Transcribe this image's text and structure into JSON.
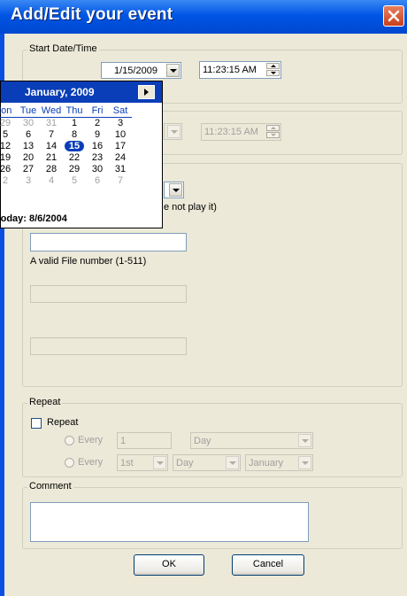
{
  "window": {
    "title": "Add/Edit your event"
  },
  "start": {
    "legend": "Start Date/Time",
    "date": "1/15/2009",
    "time": "11:23:15 AM"
  },
  "end": {
    "time": "11:23:15 AM"
  },
  "calendar": {
    "month": "January, 2009",
    "weekdays": [
      "lon",
      "Tue",
      "Wed",
      "Thu",
      "Fri",
      "Sat"
    ],
    "weeks": [
      [
        "29",
        "30",
        "31",
        "1",
        "2",
        "3"
      ],
      [
        "5",
        "6",
        "7",
        "8",
        "9",
        "10"
      ],
      [
        "12",
        "13",
        "14",
        "15",
        "16",
        "17"
      ],
      [
        "19",
        "20",
        "21",
        "22",
        "23",
        "24"
      ],
      [
        "26",
        "27",
        "28",
        "29",
        "30",
        "31"
      ],
      [
        "2",
        "3",
        "4",
        "5",
        "6",
        "7"
      ]
    ],
    "selected": "15",
    "today": "'oday: 8/6/2004"
  },
  "action": {
    "note": "e not play it)",
    "file_hint": "A valid File number (1-511)"
  },
  "repeat": {
    "legend": "Repeat",
    "checkbox_label": "Repeat",
    "every_label": "Every",
    "every_value": "1",
    "every_unit": "Day",
    "every2_label": "Every",
    "ordinal": "1st",
    "day": "Day",
    "month": "January"
  },
  "comment": {
    "legend": "Comment",
    "value": ""
  },
  "buttons": {
    "ok": "OK",
    "cancel": "Cancel"
  },
  "colors": {
    "titlebar": "#0055E5",
    "selection": "#0A3EB8",
    "face": "#ECE9D8"
  }
}
